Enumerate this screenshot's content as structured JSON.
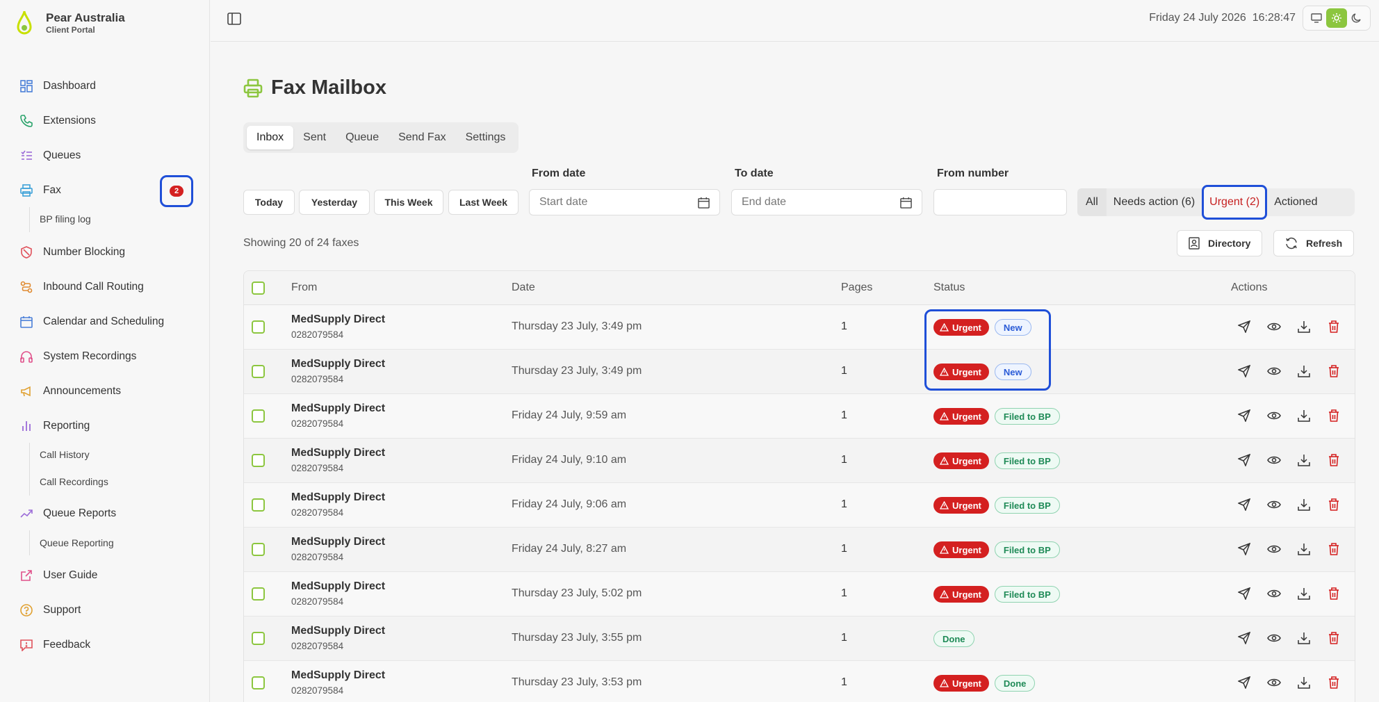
{
  "brand": {
    "name": "Pear Australia",
    "subtitle": "Client Portal"
  },
  "colors": {
    "accent": "#8cc63f",
    "urgent": "#d42020",
    "highlight": "#1f4fd8"
  },
  "sidebar": {
    "items": [
      {
        "label": "Dashboard",
        "icon": "dashboard-icon"
      },
      {
        "label": "Extensions",
        "icon": "phone-icon"
      },
      {
        "label": "Queues",
        "icon": "list-icon"
      },
      {
        "label": "Fax",
        "icon": "printer-icon",
        "badge": "2"
      },
      {
        "label": "Number Blocking",
        "icon": "block-icon"
      },
      {
        "label": "Inbound Call Routing",
        "icon": "route-icon"
      },
      {
        "label": "Calendar and Scheduling",
        "icon": "calendar-icon"
      },
      {
        "label": "System Recordings",
        "icon": "headphones-icon"
      },
      {
        "label": "Announcements",
        "icon": "megaphone-icon"
      },
      {
        "label": "Reporting",
        "icon": "bar-chart-icon"
      },
      {
        "label": "Queue Reports",
        "icon": "trend-icon"
      },
      {
        "label": "User Guide",
        "icon": "external-link-icon"
      },
      {
        "label": "Support",
        "icon": "help-icon"
      },
      {
        "label": "Feedback",
        "icon": "feedback-icon"
      }
    ],
    "fax_sub": "BP filing log",
    "reporting_sub": [
      "Call History",
      "Call Recordings"
    ],
    "queue_reports_sub": "Queue Reporting"
  },
  "topbar": {
    "date": "Friday 24 July 2026",
    "time": "16:28:47"
  },
  "page": {
    "title": "Fax Mailbox"
  },
  "tabs": [
    "Inbox",
    "Sent",
    "Queue",
    "Send Fax",
    "Settings"
  ],
  "quick": [
    "Today",
    "Yesterday",
    "This Week",
    "Last Week"
  ],
  "filters": {
    "from_date_label": "From date",
    "from_date_placeholder": "Start date",
    "to_date_label": "To date",
    "to_date_placeholder": "End date",
    "from_number_label": "From number",
    "from_number_value": ""
  },
  "segments": {
    "all": "All",
    "needs": "Needs action (6)",
    "urgent": "Urgent (2)",
    "actioned": "Actioned"
  },
  "showing": "Showing 20 of 24 faxes",
  "actions": {
    "directory": "Directory",
    "refresh": "Refresh"
  },
  "table": {
    "headers": {
      "from": "From",
      "date": "Date",
      "pages": "Pages",
      "status": "Status",
      "actions": "Actions"
    },
    "rows": [
      {
        "name": "MedSupply Direct",
        "number": "0282079584",
        "date": "Thursday 23 July, 3:49 pm",
        "pages": "1",
        "urgent": "Urgent",
        "tag": "New"
      },
      {
        "name": "MedSupply Direct",
        "number": "0282079584",
        "date": "Thursday 23 July, 3:49 pm",
        "pages": "1",
        "urgent": "Urgent",
        "tag": "New"
      },
      {
        "name": "MedSupply Direct",
        "number": "0282079584",
        "date": "Friday 24 July, 9:59 am",
        "pages": "1",
        "urgent": "Urgent",
        "tag": "Filed to BP"
      },
      {
        "name": "MedSupply Direct",
        "number": "0282079584",
        "date": "Friday 24 July, 9:10 am",
        "pages": "1",
        "urgent": "Urgent",
        "tag": "Filed to BP"
      },
      {
        "name": "MedSupply Direct",
        "number": "0282079584",
        "date": "Friday 24 July, 9:06 am",
        "pages": "1",
        "urgent": "Urgent",
        "tag": "Filed to BP"
      },
      {
        "name": "MedSupply Direct",
        "number": "0282079584",
        "date": "Friday 24 July, 8:27 am",
        "pages": "1",
        "urgent": "Urgent",
        "tag": "Filed to BP"
      },
      {
        "name": "MedSupply Direct",
        "number": "0282079584",
        "date": "Thursday 23 July, 5:02 pm",
        "pages": "1",
        "urgent": "Urgent",
        "tag": "Filed to BP"
      },
      {
        "name": "MedSupply Direct",
        "number": "0282079584",
        "date": "Thursday 23 July, 3:55 pm",
        "pages": "1",
        "urgent": "",
        "tag": "Done"
      },
      {
        "name": "MedSupply Direct",
        "number": "0282079584",
        "date": "Thursday 23 July, 3:53 pm",
        "pages": "1",
        "urgent": "Urgent",
        "tag": "Done"
      }
    ]
  }
}
